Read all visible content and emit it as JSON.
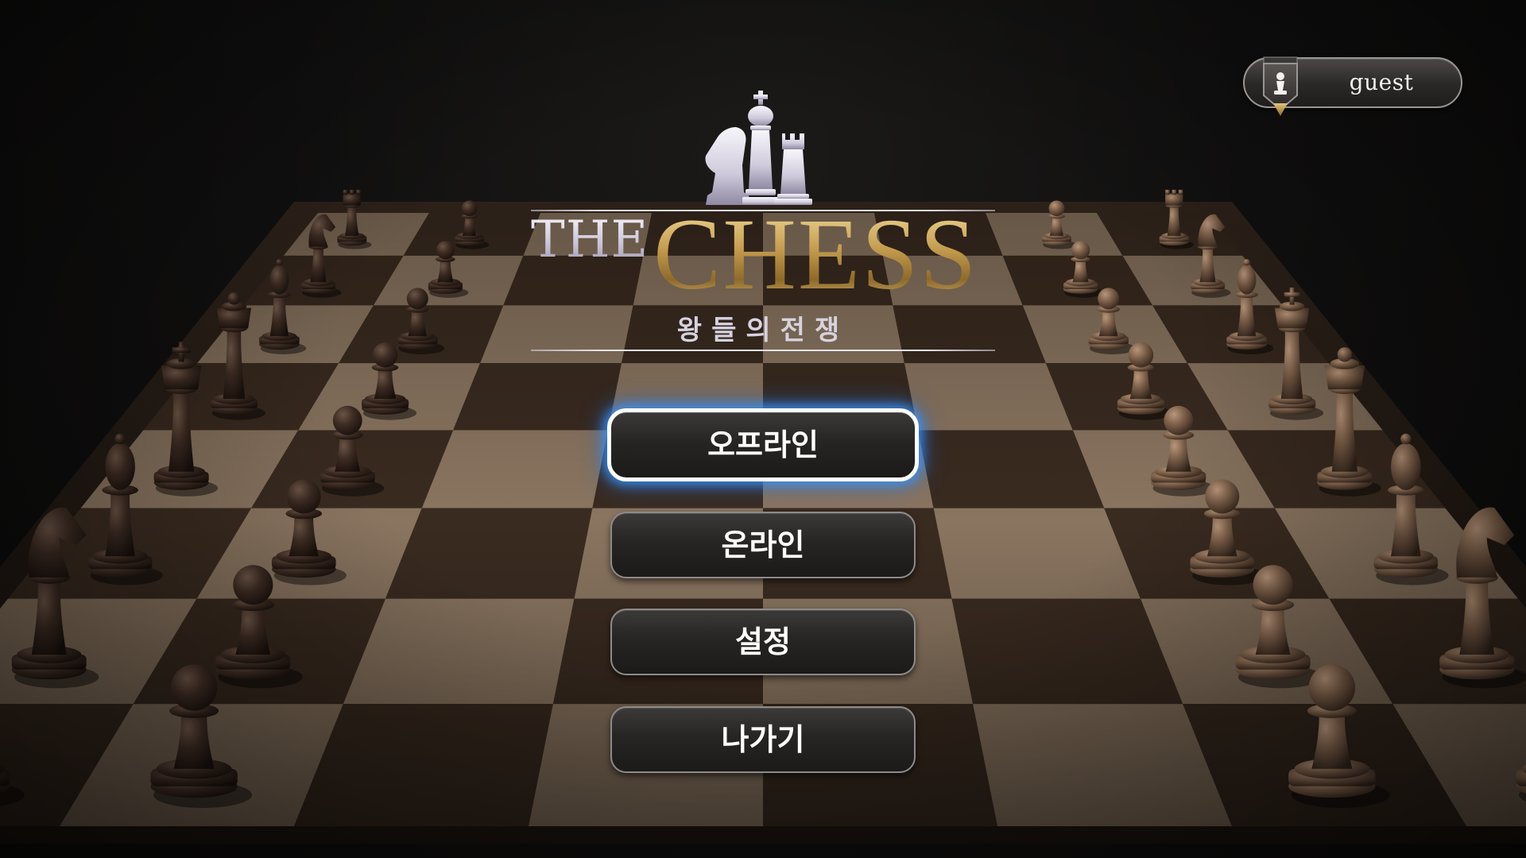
{
  "app": {
    "title": "THE CHESS",
    "title_prefix": "THE",
    "title_main": "CHESS",
    "subtitle": "왕들의전쟁"
  },
  "user": {
    "name": "guest",
    "emblem_icon": "pawn-shield-icon"
  },
  "menu": {
    "selected_index": 0,
    "items": [
      {
        "label": "오프라인"
      },
      {
        "label": "온라인"
      },
      {
        "label": "설정"
      },
      {
        "label": "나가기"
      }
    ]
  },
  "colors": {
    "board_light": "#8a7560",
    "board_dark": "#3a2b20",
    "board_frame": "#2a1f18",
    "dark_pieces": "#3b2a21",
    "light_pieces": "#7a5e49",
    "title_gold": "#c9a55a",
    "title_silver": "#d9d5e3",
    "button_focus_glow": "#3a96ff"
  },
  "board": {
    "files": 8,
    "ranks": 8
  }
}
